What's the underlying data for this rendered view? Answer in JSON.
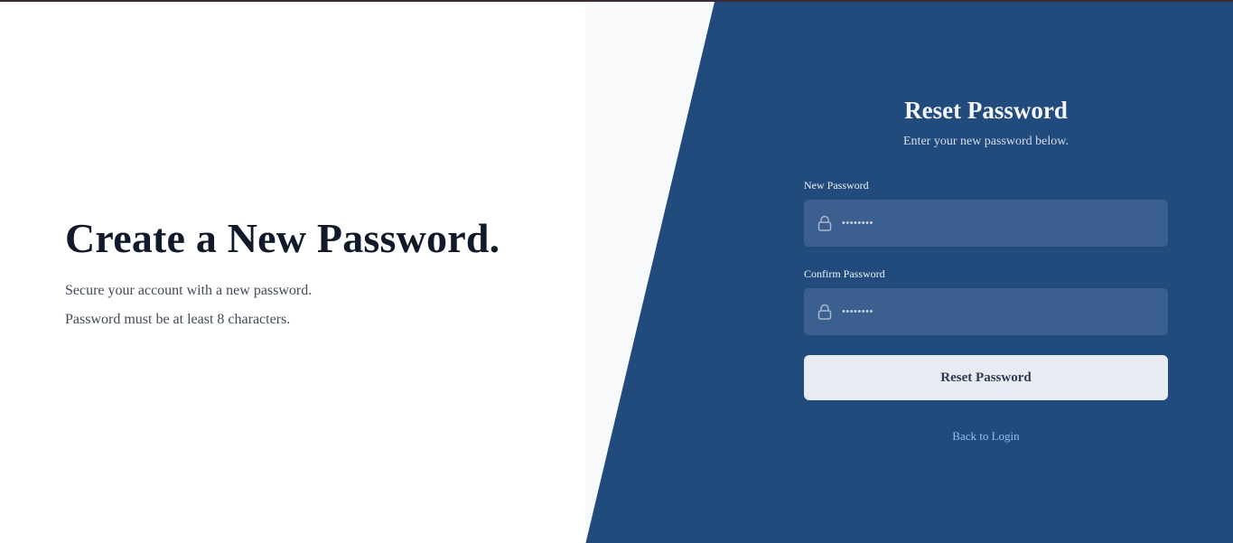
{
  "hero": {
    "heading": "Create a New Password.",
    "line1": "Secure your account with a new password.",
    "line2": "Password must be at least 8 characters."
  },
  "form": {
    "title": "Reset Password",
    "subtitle": "Enter your new password below.",
    "new_password": {
      "label": "New Password",
      "placeholder": "••••••••",
      "icon": "lock-icon"
    },
    "confirm_password": {
      "label": "Confirm Password",
      "placeholder": "••••••••",
      "icon": "lock-icon"
    },
    "submit_label": "Reset Password",
    "back_link": "Back to Login"
  },
  "colors": {
    "panel": "#214a7d",
    "input_bg": "#3b5f8e",
    "button_bg": "#e8ebf2",
    "link": "#8ec1f5",
    "heading": "#111a2b"
  }
}
